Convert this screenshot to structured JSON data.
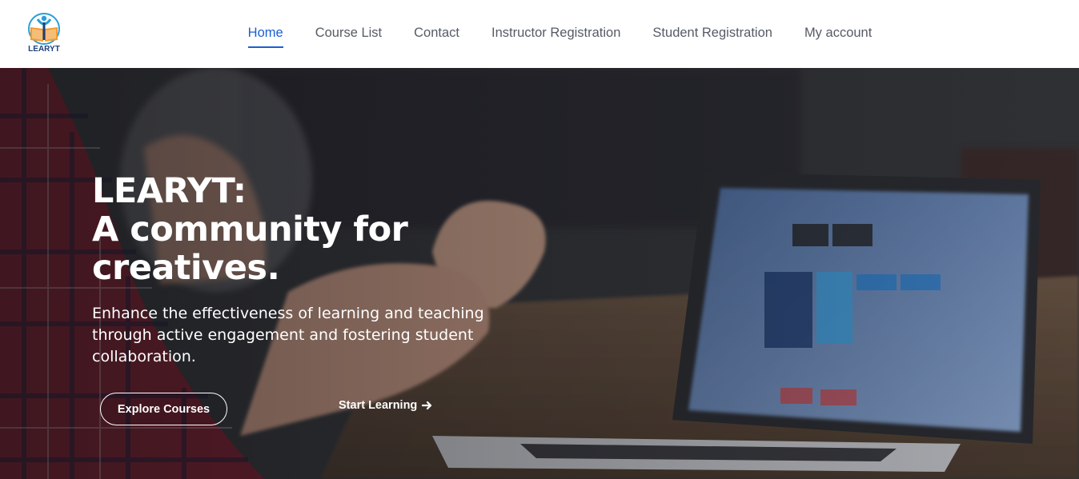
{
  "brand": {
    "logo_text": "LEARYT",
    "colors": {
      "teal": "#2a9fd6",
      "orange": "#f29a2e",
      "navy": "#1d3f7a"
    }
  },
  "nav": {
    "items": [
      {
        "label": "Home",
        "active": true
      },
      {
        "label": "Course List"
      },
      {
        "label": "Contact"
      },
      {
        "label": "Instructor Registration"
      },
      {
        "label": "Student Registration"
      },
      {
        "label": "My account"
      }
    ],
    "active_color": "#1a5fd4"
  },
  "hero": {
    "headline_line1": "LEARYT:",
    "headline_line2": "A community for",
    "headline_line3": "creatives.",
    "subtext": "Enhance the effectiveness of learning and teaching through active engagement and fostering student collaboration.",
    "explore_label": "Explore Courses",
    "start_label": "Start Learning",
    "start_icon": "arrow-right-icon"
  }
}
